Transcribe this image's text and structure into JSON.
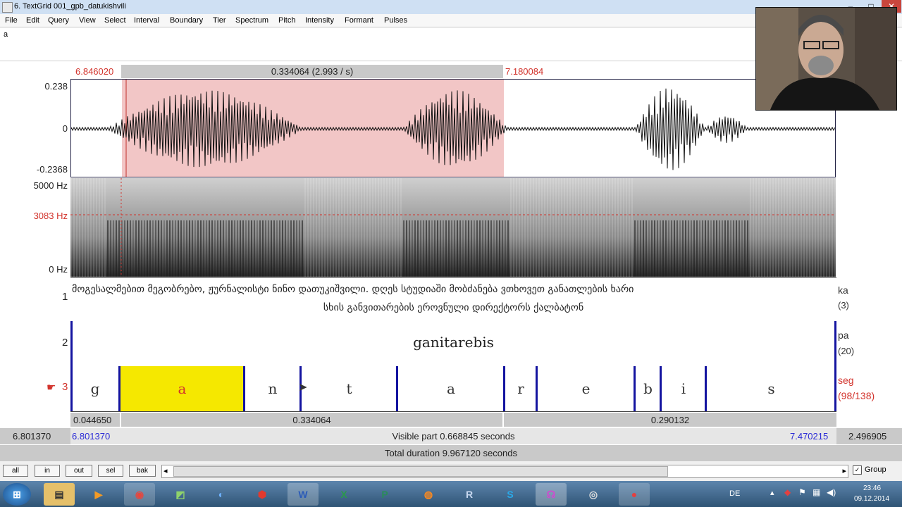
{
  "window": {
    "title": "6. TextGrid 001_gpb_datukishvili",
    "controls": [
      "–",
      "□",
      "✕"
    ]
  },
  "menu": [
    "File",
    "Edit",
    "Query",
    "View",
    "Select",
    "Interval",
    "Boundary",
    "Tier",
    "Spectrum",
    "Pitch",
    "Intensity",
    "Formant",
    "Pulses"
  ],
  "text_field": {
    "value": "a"
  },
  "selection": {
    "start": "6.846020",
    "duration": "0.334064 (2.993 / s)",
    "end": "7.180084"
  },
  "waveform": {
    "ymax": "0.238",
    "zero": "0",
    "ymin": "-0.2368"
  },
  "spectrogram": {
    "fmax": "5000 Hz",
    "cursor_freq": "3083 Hz",
    "fmin": "0 Hz"
  },
  "tier1": {
    "number": "1",
    "line1": "მოგესალმებით მეგობრებო, ჟურნალისტი ნინო დათუკიშვილი. დღეს სტუდიაში მობძანება ვთხოვეთ განათლების ხარი",
    "line2": "სხის განვითარების ეროვნული დირექტორს ქალბატონ",
    "name": "ka",
    "count": "(3)"
  },
  "tier2": {
    "number": "2",
    "label": "ganitarebis",
    "name": "pa",
    "count": "(20)"
  },
  "tier3": {
    "number": "3",
    "name": "seg",
    "count": "(98/138)",
    "segments": [
      {
        "label": "g"
      },
      {
        "label": "a"
      },
      {
        "label": "n"
      },
      {
        "label": "t"
      },
      {
        "label": "a"
      },
      {
        "label": "r"
      },
      {
        "label": "e"
      },
      {
        "label": "b"
      },
      {
        "label": "i"
      },
      {
        "label": "s"
      }
    ]
  },
  "durations_row": {
    "left": "0.044650",
    "middle": "0.334064",
    "right": "0.290132"
  },
  "visible_row": {
    "outer_left": "6.801370",
    "window_start": "6.801370",
    "visible": "Visible part 0.668845 seconds",
    "window_end": "7.470215",
    "outer_right": "2.496905"
  },
  "total_row": {
    "total": "Total duration 9.967120 seconds"
  },
  "nav_buttons": [
    "all",
    "in",
    "out",
    "sel",
    "bak"
  ],
  "scroll": {
    "left_arrow": "◂",
    "right_arrow": "▸"
  },
  "group": {
    "label": "Group",
    "checked": true
  },
  "taskbar": {
    "apps": [
      "Start",
      "Explorer",
      "Media",
      "Chrome",
      "Praat",
      "Lync",
      "Acrobat",
      "Word",
      "Excel",
      "Publisher",
      "Firefox",
      "R",
      "Skype",
      "Praat2",
      "Sound",
      "Record"
    ],
    "lang": "DE",
    "time": "23:46",
    "date": "09.12.2014"
  },
  "colors": {
    "selection": "#f2c6c6",
    "active_segment": "#f5e800",
    "boundary": "#1414a0",
    "red_time": "#d2332c",
    "blue_time": "#2b2bd6"
  }
}
